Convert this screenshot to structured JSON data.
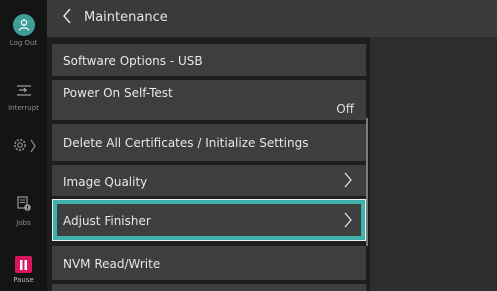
{
  "rail": {
    "logout_label": "Log Out",
    "interrupt_label": "Interrupt",
    "jobs_label": "Jobs",
    "pause_label": "Pause"
  },
  "header": {
    "title": "Maintenance"
  },
  "list": {
    "items": [
      {
        "label": "Software Options - USB"
      },
      {
        "label": "Power On Self-Test",
        "value": "Off"
      },
      {
        "label": "Delete All Certificates / Initialize Settings"
      },
      {
        "label": "Image Quality"
      },
      {
        "label": "Adjust Finisher"
      },
      {
        "label": "NVM Read/Write"
      }
    ]
  },
  "colors": {
    "accent": "#3fb1ac",
    "pause": "#d7165f"
  },
  "icons": [
    "person-icon",
    "interrupt-icon",
    "settings-icon",
    "jobs-icon",
    "pause-icon",
    "chevron-left-icon",
    "chevron-right-icon"
  ]
}
